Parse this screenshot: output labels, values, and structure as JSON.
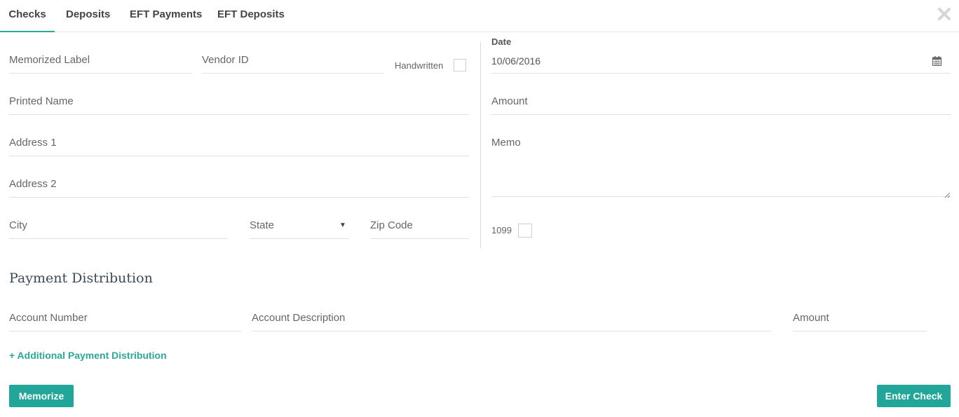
{
  "tabs": [
    {
      "label": "Checks",
      "active": true
    },
    {
      "label": "Deposits",
      "active": false
    },
    {
      "label": "EFT Payments",
      "active": false
    },
    {
      "label": "EFT Deposits",
      "active": false
    }
  ],
  "close_icon": "close-icon",
  "form": {
    "memorized_label": "Memorized Label",
    "vendor_id": "Vendor ID",
    "handwritten_label": "Handwritten",
    "printed_name": "Printed Name",
    "address1": "Address 1",
    "address2": "Address 2",
    "city": "City",
    "state": "State",
    "zip": "Zip Code",
    "date_label": "Date",
    "date_value": "10/06/2016",
    "amount": "Amount",
    "memo": "Memo",
    "label_1099": "1099"
  },
  "distribution": {
    "title": "Payment Distribution",
    "account_number": "Account Number",
    "account_description": "Account Description",
    "amount": "Amount",
    "add_link": "+ Additional Payment Distribution"
  },
  "buttons": {
    "memorize": "Memorize",
    "enter_check": "Enter Check"
  },
  "colors": {
    "accent": "#21a699",
    "title": "#3a4a57"
  }
}
